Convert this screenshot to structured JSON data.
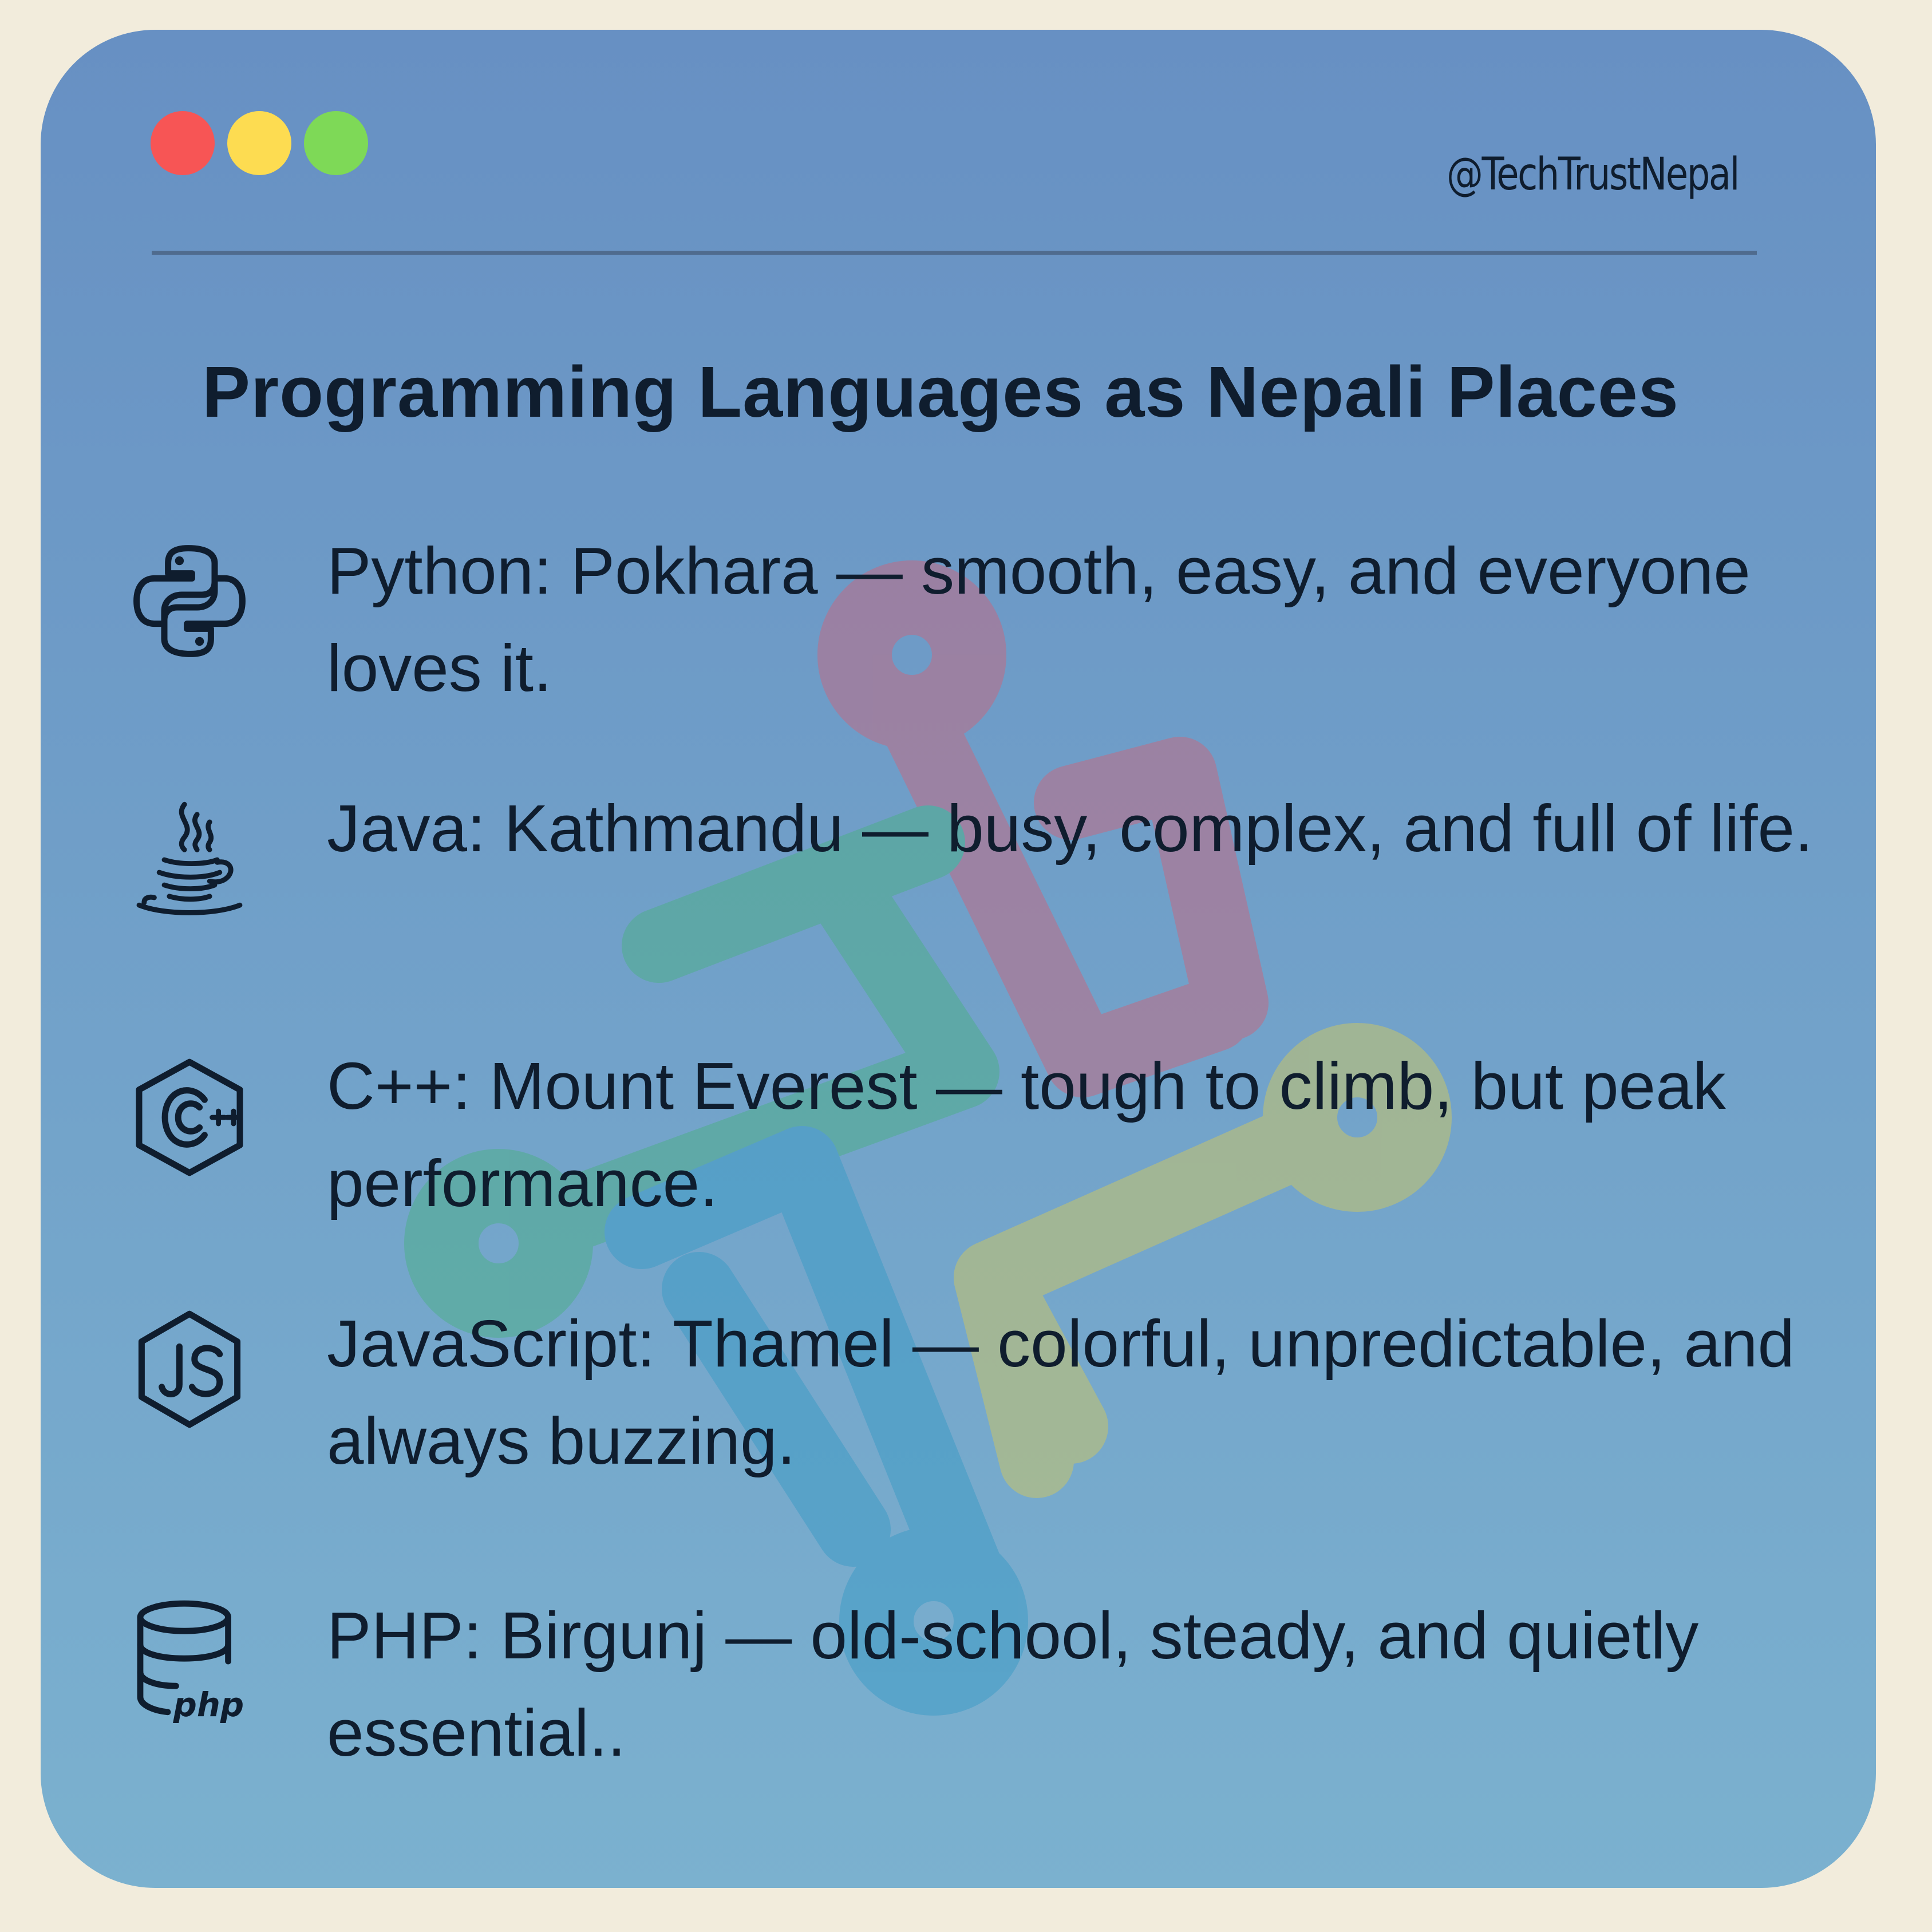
{
  "window_controls": {
    "colors": [
      "#f75555",
      "#fddc51",
      "#7ed957"
    ]
  },
  "header": {
    "handle": "@TechTrustNepal"
  },
  "title": "Programming Languages as Nepali Places",
  "items": [
    {
      "icon": "python-icon",
      "text": "Python: Pokhara — smooth, easy, and everyone loves it."
    },
    {
      "icon": "java-icon",
      "text": "Java: Kathmandu — busy, complex, and full of life."
    },
    {
      "icon": "cpp-icon",
      "text": "C++: Mount Everest — tough to climb, but peak performance."
    },
    {
      "icon": "javascript-icon",
      "text": "JavaScript: Thamel — colorful, unpredictable, and always buzzing."
    },
    {
      "icon": "php-icon",
      "text": "PHP: Birgunj — old-school, steady, and quietly essential.."
    }
  ],
  "php_icon_label": "php",
  "colors": {
    "card_top": "#6790c3",
    "card_bottom": "#7bb1cf",
    "page_bg": "#f2ecdc",
    "text": "#0f1d2e",
    "watermark_red": "#b07a92",
    "watermark_green": "#5faa9c",
    "watermark_yellow": "#a8b67f",
    "watermark_blue": "#4a9ec4"
  }
}
